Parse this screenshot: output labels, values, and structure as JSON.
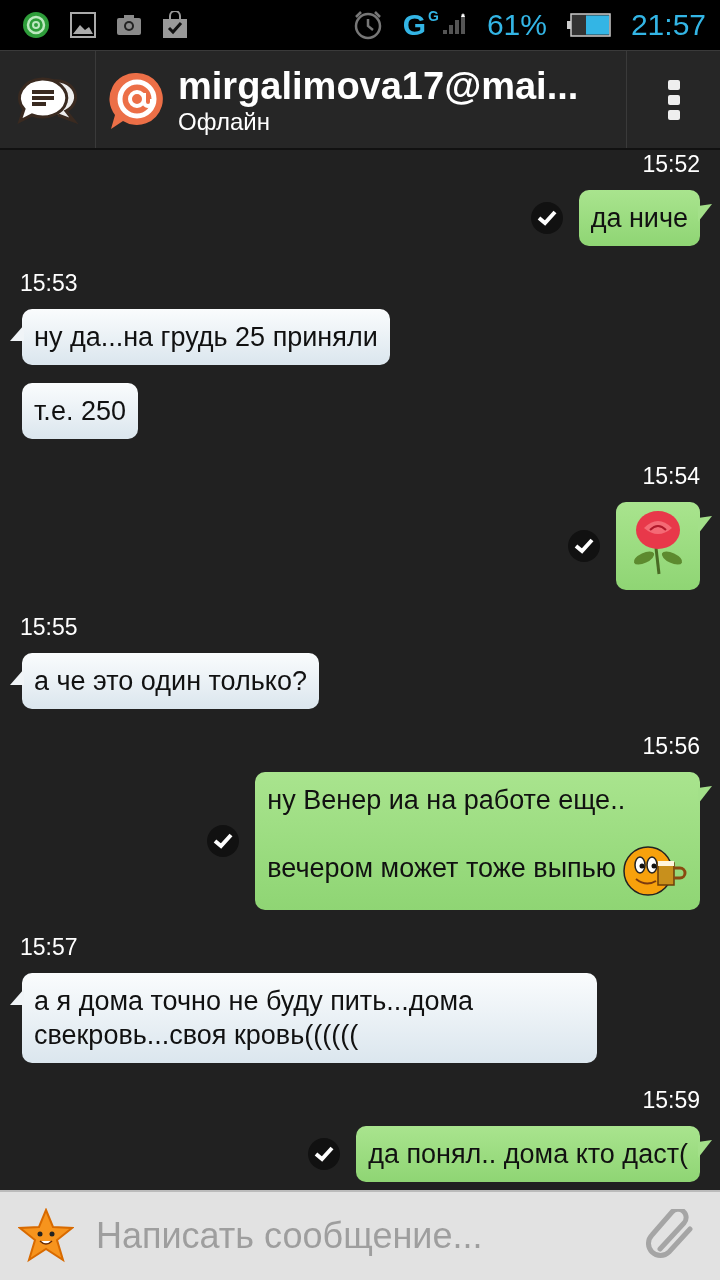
{
  "status_bar": {
    "network": "G",
    "network_sub": "G",
    "battery_text": "61%",
    "time": "21:57"
  },
  "header": {
    "title": "mirgalimova17@mai...",
    "status": "Офлайн"
  },
  "groups": [
    {
      "time": "15:52",
      "kind": "outgoing",
      "bubbles": [
        {
          "kind": "text",
          "paragraphs": [
            "да ниче"
          ],
          "delivered": true
        }
      ]
    },
    {
      "time": "15:53",
      "kind": "incoming",
      "bubbles": [
        {
          "kind": "text",
          "paragraphs": [
            "ну да...на грудь 25 приняли"
          ]
        },
        {
          "kind": "text",
          "paragraphs": [
            "т.е. 250"
          ]
        }
      ]
    },
    {
      "time": "15:54",
      "kind": "outgoing",
      "bubbles": [
        {
          "kind": "sticker",
          "delivered": true
        }
      ]
    },
    {
      "time": "15:55",
      "kind": "incoming",
      "bubbles": [
        {
          "kind": "text",
          "paragraphs": [
            "а че это один только?"
          ]
        }
      ]
    },
    {
      "time": "15:56",
      "kind": "outgoing",
      "bubbles": [
        {
          "kind": "text",
          "paragraphs": [
            "ну Венер иа на работе еще..",
            "вечером может тоже выпью"
          ],
          "emoticon": true,
          "delivered": true
        }
      ]
    },
    {
      "time": "15:57",
      "kind": "incoming",
      "bubbles": [
        {
          "kind": "text",
          "paragraphs": [
            "а я дома точно не буду пить...дома свекровь...своя кровь(((((("
          ]
        }
      ]
    },
    {
      "time": "15:59",
      "kind": "outgoing",
      "bubbles": [
        {
          "kind": "text",
          "paragraphs": [
            "да понял.. дома кто даст("
          ],
          "delivered": true
        }
      ]
    }
  ],
  "composer": {
    "placeholder": "Написать сообщение..."
  }
}
